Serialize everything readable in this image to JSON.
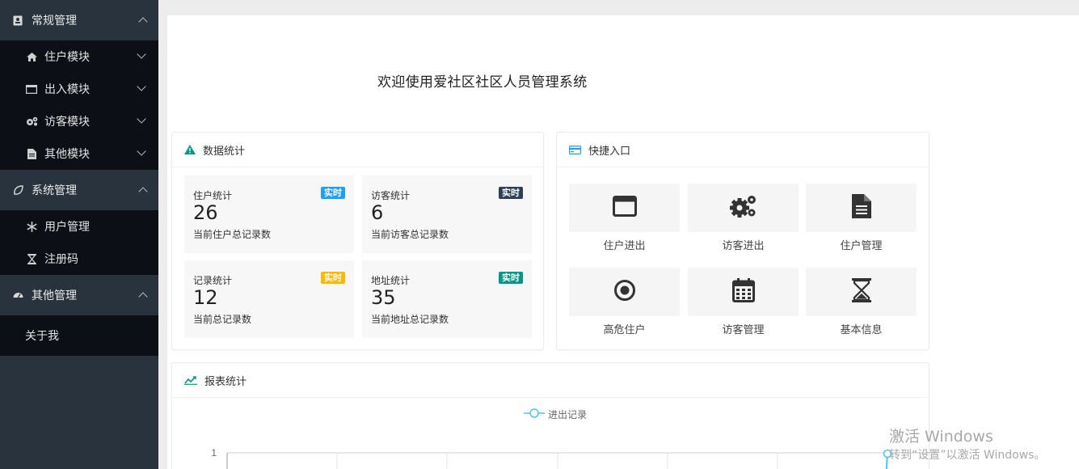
{
  "sidebar": {
    "groups": [
      {
        "label": "常规管理",
        "icon": "book-icon",
        "items": [
          {
            "label": "住户模块",
            "icon": "home-icon"
          },
          {
            "label": "出入模块",
            "icon": "window-icon"
          },
          {
            "label": "访客模块",
            "icon": "gears-icon"
          },
          {
            "label": "其他模块",
            "icon": "file-icon"
          }
        ]
      },
      {
        "label": "系统管理",
        "icon": "leaf-icon",
        "items": [
          {
            "label": "用户管理",
            "icon": "snowflake-icon"
          },
          {
            "label": "注册码",
            "icon": "hourglass-icon"
          }
        ]
      },
      {
        "label": "其他管理",
        "icon": "dashboard-icon",
        "items": [
          {
            "label": "关于我"
          }
        ]
      }
    ]
  },
  "main": {
    "welcome": "欢迎使用爱社区社区人员管理系统",
    "stats_card": {
      "title": "数据统计",
      "items": [
        {
          "label": "住户统计",
          "badge": "实时",
          "badge_color": "#1e9fff",
          "value": "26",
          "desc": "当前住户总记录数"
        },
        {
          "label": "访客统计",
          "badge": "实时",
          "badge_color": "#2f4056",
          "value": "6",
          "desc": "当前访客总记录数"
        },
        {
          "label": "记录统计",
          "badge": "实时",
          "badge_color": "#ffb800",
          "value": "12",
          "desc": "当前总记录数"
        },
        {
          "label": "地址统计",
          "badge": "实时",
          "badge_color": "#009688",
          "value": "35",
          "desc": "当前地址总记录数"
        }
      ]
    },
    "quick_card": {
      "title": "快捷入口",
      "items": [
        {
          "label": "住户进出",
          "icon": "window-icon"
        },
        {
          "label": "访客进出",
          "icon": "gears-icon"
        },
        {
          "label": "住户管理",
          "icon": "file-icon"
        },
        {
          "label": "高危住户",
          "icon": "dot-circle-icon"
        },
        {
          "label": "访客管理",
          "icon": "calendar-icon"
        },
        {
          "label": "基本信息",
          "icon": "hourglass-icon"
        }
      ]
    },
    "report_card": {
      "title": "报表统计",
      "legend": "进出记录",
      "y_tick": "1"
    }
  },
  "colors": {
    "sidebar_bg": "#28333e",
    "submenu_bg": "#0c1016",
    "accent_teal": "#009688",
    "chart_line": "#4fc3f7"
  },
  "chart_data": {
    "type": "line",
    "series": [
      {
        "name": "进出记录",
        "values": []
      }
    ],
    "ylim": [
      0,
      1
    ],
    "yticks": [
      "1"
    ]
  },
  "watermark": {
    "line1": "激活 Windows",
    "line2": "转到“设置”以激活 Windows。"
  }
}
